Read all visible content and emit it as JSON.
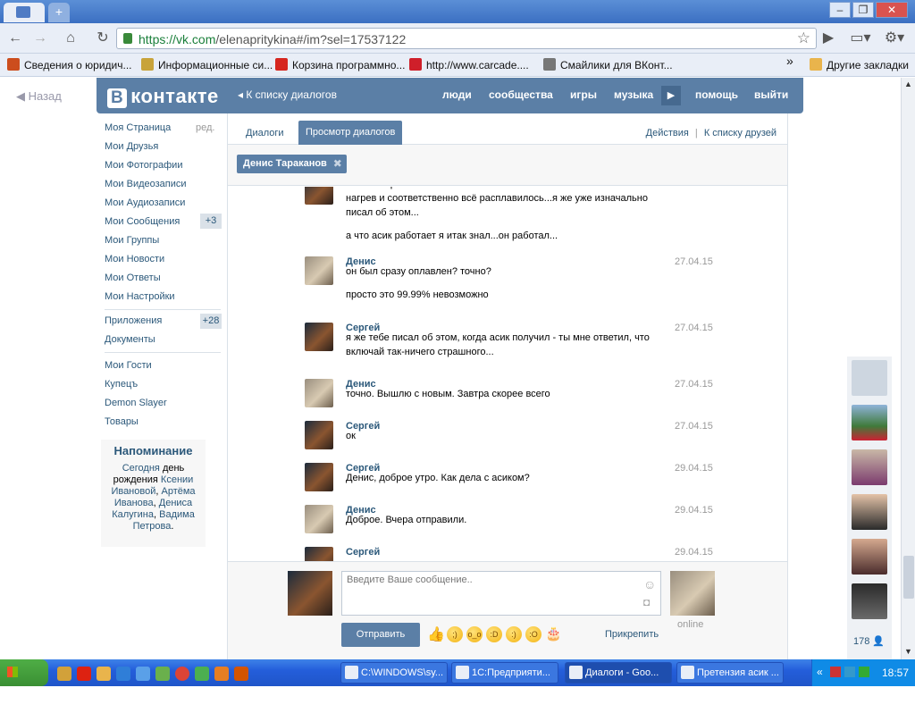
{
  "browser": {
    "url_host": "https://vk.com",
    "url_path": "/elenapritykina#/im?sel=17537122",
    "window_controls": [
      "–",
      "❐",
      "✕"
    ]
  },
  "bookmarks": [
    {
      "label": "Сведения о юридич...",
      "color": "#cc4d1d"
    },
    {
      "label": "Информационные си...",
      "color": "#c8a33a"
    },
    {
      "label": "Корзина программно...",
      "color": "#d6261f"
    },
    {
      "label": "http://www.carcade....",
      "color": "#cf1f2a"
    },
    {
      "label": "Смайлики для ВКонт...",
      "color": "#777777"
    }
  ],
  "bookmarks_more": "»",
  "bookmarks_other": "Другие закладки",
  "page": {
    "back": "Назад",
    "logo_b": "В",
    "logo_text": "контакте",
    "to_dialog_list": "К списку диалогов",
    "nav": {
      "people": "люди",
      "communities": "сообщества",
      "games": "игры",
      "music": "музыка",
      "help": "помощь",
      "logout": "выйти"
    }
  },
  "menu": {
    "edit": "ред.",
    "items": [
      "Моя Страница",
      "Мои Друзья",
      "Мои Фотографии",
      "Мои Видеозаписи",
      "Мои Аудиозаписи",
      "Мои Сообщения",
      "Мои Группы",
      "Мои Новости",
      "Мои Ответы",
      "Мои Настройки"
    ],
    "messages_count": "+3",
    "apps": "Приложения",
    "apps_count": "+28",
    "docs": "Документы",
    "extra": [
      "Мои Гости",
      "Купецъ",
      "Demon Slayer",
      "Товары"
    ]
  },
  "reminder": {
    "title": "Напоминание",
    "today": "Сегодня",
    "birthday_of": "день рождения",
    "names": [
      "Ксении Ивановой",
      "Артёма Иванова",
      "Дениса Калугина",
      "Вадима Петрова"
    ]
  },
  "dialog": {
    "tab_dialogs": "Диалоги",
    "tab_view": "Просмотр диалогов",
    "actions": "Действия",
    "sep": "|",
    "to_friends": "К списку друзей",
    "peer": "Денис Тараканов"
  },
  "messages": [
    {
      "author": "",
      "date": "",
      "av": "s",
      "lines": [
        "так штекер блока питания и был изначально оплавленный - от этого нагрев и соответственно всё расплавилось...я же уже изначально писал об этом...",
        "а что асик работает я итак знал...он работал..."
      ]
    },
    {
      "author": "Денис",
      "date": "27.04.15",
      "av": "d",
      "lines": [
        "он был сразу оплавлен? точно?",
        "просто это 99.99% невозможно"
      ]
    },
    {
      "author": "Сергей",
      "date": "27.04.15",
      "av": "s",
      "lines": [
        "я же тебе писал об этом, когда асик получил - ты мне ответил, что включай так-ничего страшного..."
      ]
    },
    {
      "author": "Денис",
      "date": "27.04.15",
      "av": "d",
      "lines": [
        "точно. Вышлю с новым. Завтра скорее всего"
      ]
    },
    {
      "author": "Сергей",
      "date": "27.04.15",
      "av": "s",
      "lines": [
        "ок"
      ]
    },
    {
      "author": "Сергей",
      "date": "29.04.15",
      "av": "s",
      "lines": [
        "Денис, доброе утро. Как дела с асиком?"
      ]
    },
    {
      "author": "Денис",
      "date": "29.04.15",
      "av": "d",
      "lines": [
        "Доброе. Вчера отправили."
      ]
    },
    {
      "author": "Сергей",
      "date": "29.04.15",
      "av": "s",
      "lines": [
        ""
      ]
    }
  ],
  "compose": {
    "placeholder": "Введите Ваше сообщение..",
    "send": "Отправить",
    "attach": "Прикрепить",
    "online": "online"
  },
  "sidebar_count": "178",
  "taskbar": {
    "start": "Пуск",
    "tasks": [
      "C:\\WINDOWS\\sy...",
      "1С:Предприяти...",
      "Диалоги - Goo...",
      "Претензия асик ..."
    ],
    "active_index": 2,
    "clock": "18:57"
  }
}
